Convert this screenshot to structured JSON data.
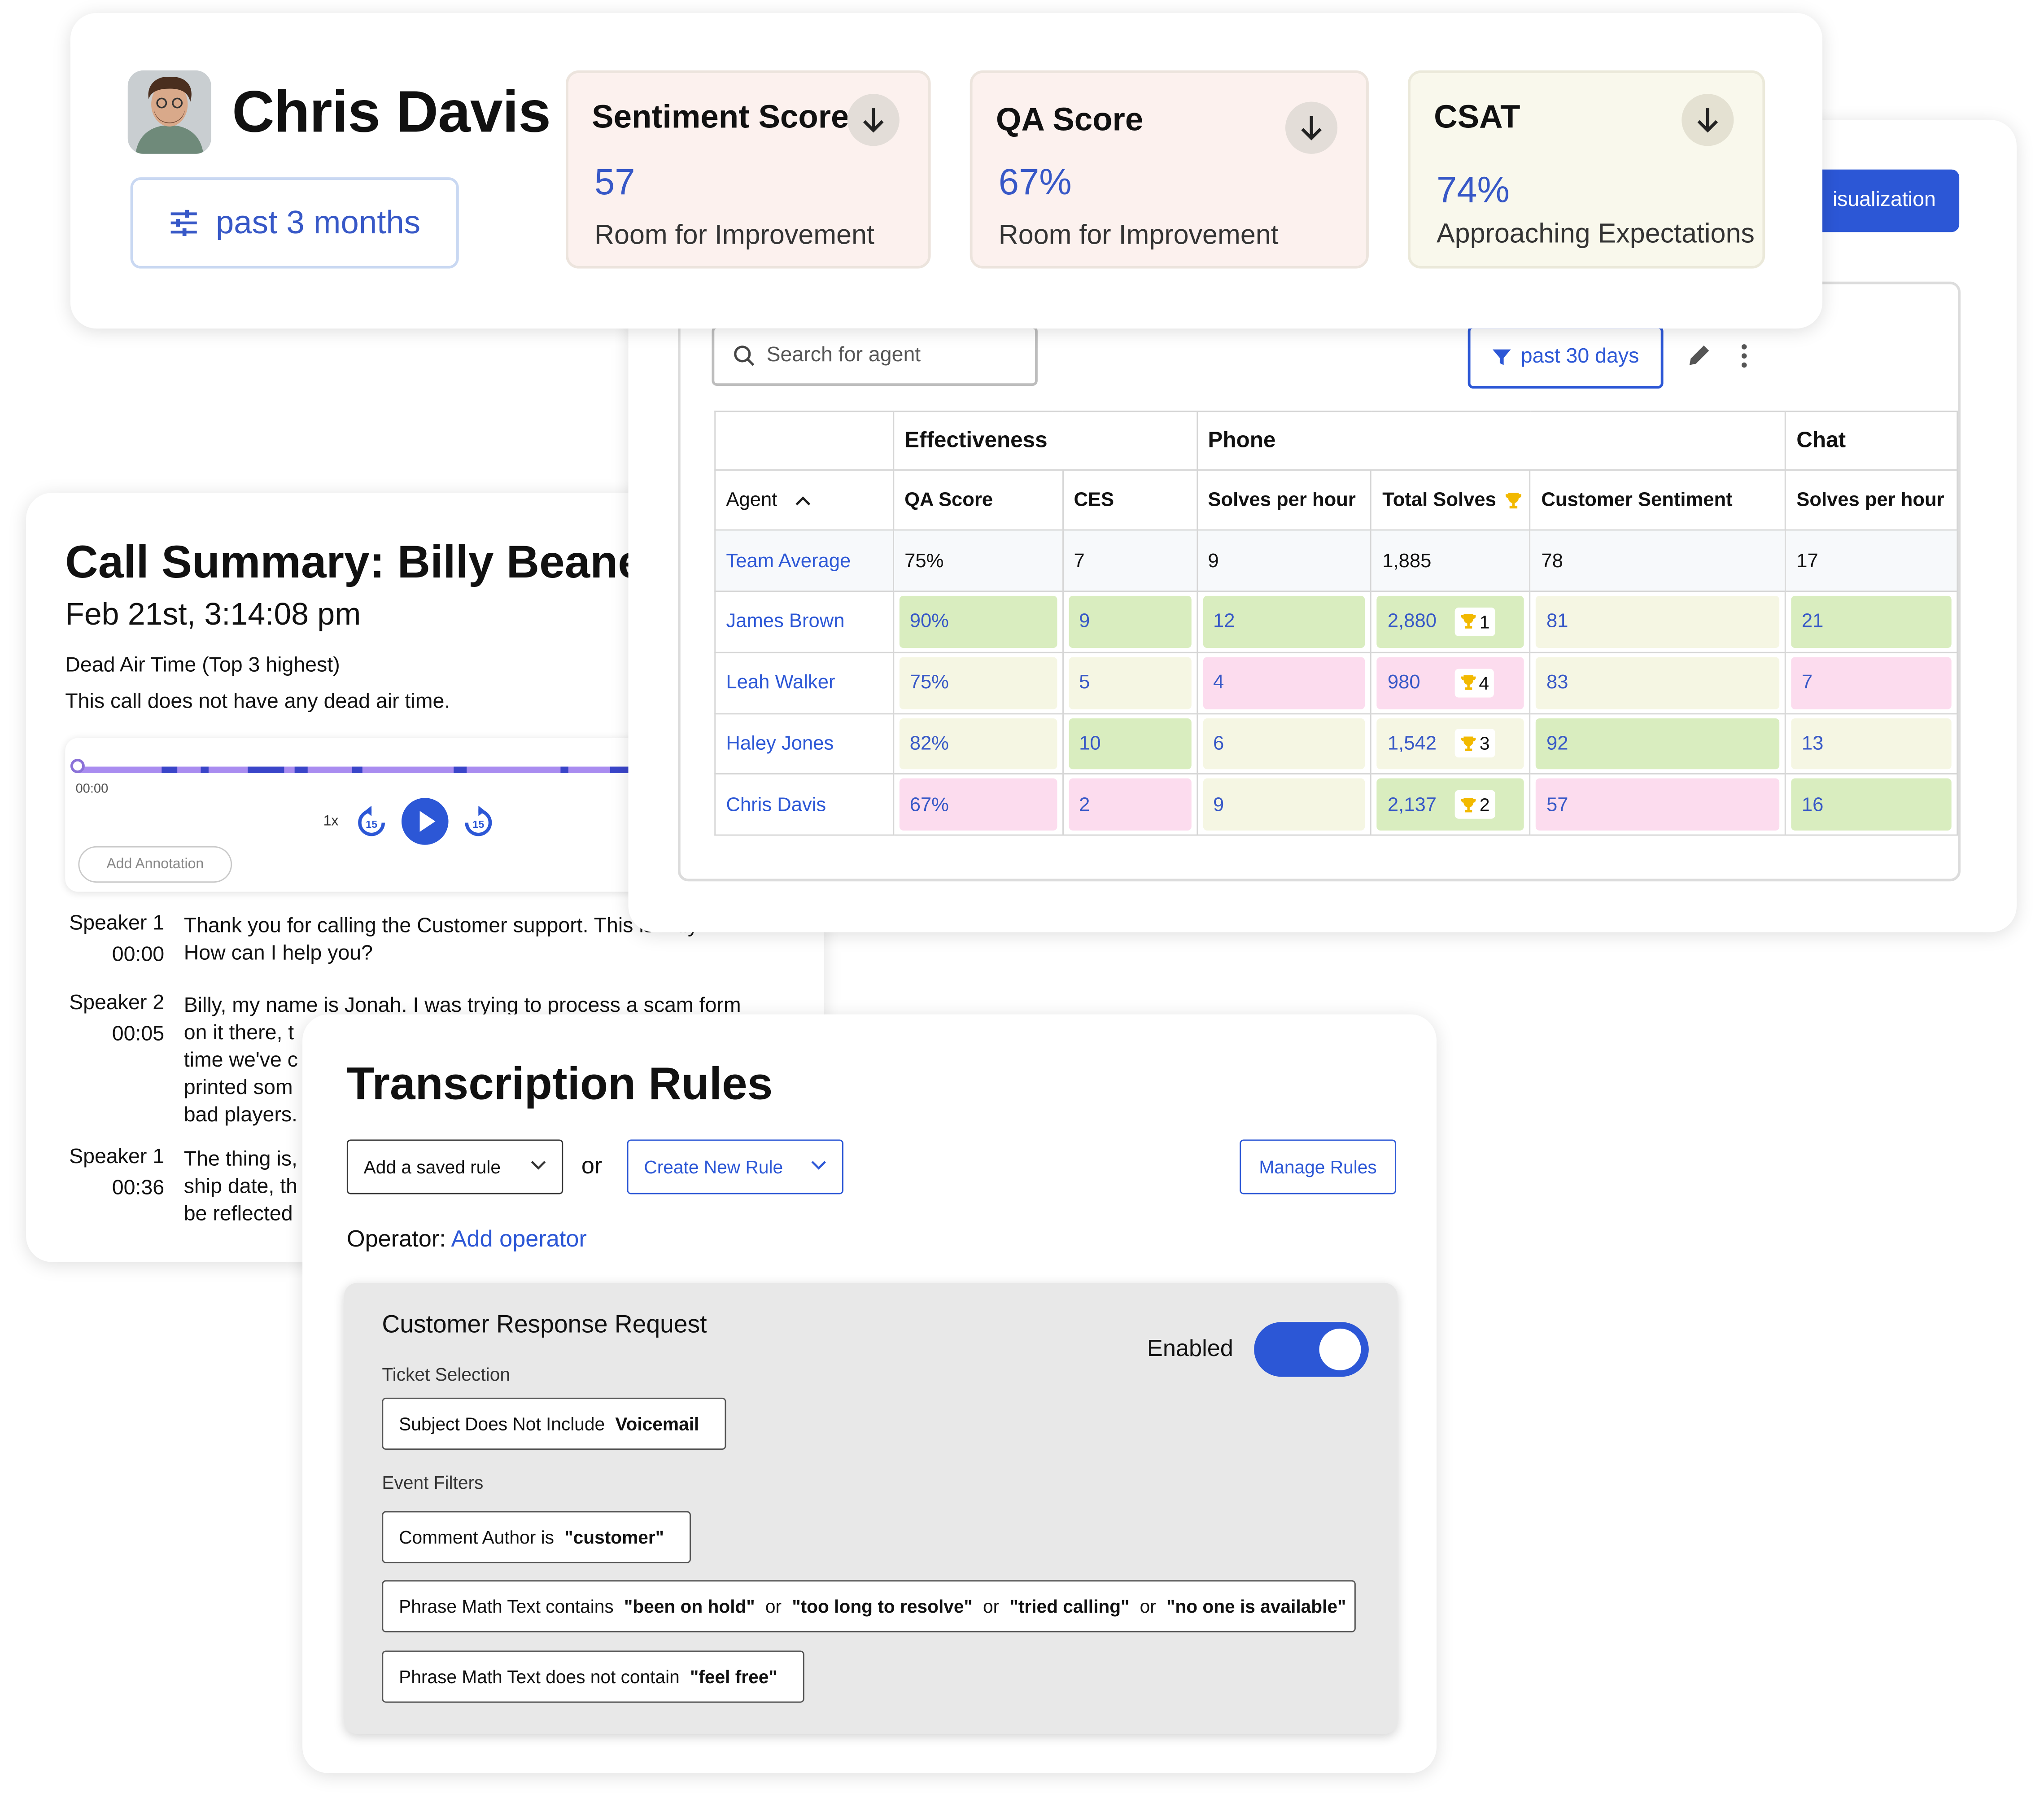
{
  "profile": {
    "name": "Chris Davis",
    "range_label": "past 3 months",
    "metrics": [
      {
        "title": "Sentiment Score",
        "value": "57",
        "desc": "Room for Improvement"
      },
      {
        "title": "QA Score",
        "value": "67%",
        "desc": "Room for Improvement"
      },
      {
        "title": "CSAT",
        "value": "74%",
        "desc": "Approaching Expectations"
      }
    ]
  },
  "table_view": {
    "viz_button": "isualization",
    "search_placeholder": "Search for agent",
    "filter_label": "past 30 days",
    "groups": [
      "Effectiveness",
      "Phone",
      "Chat"
    ],
    "columns": [
      "Agent",
      "QA Score",
      "CES",
      "Solves per hour",
      "Total Solves",
      "Customer Sentiment",
      "Solves per hour"
    ],
    "rows": [
      {
        "agent": "Team Average",
        "qa": "75%",
        "ces": "7",
        "sph": "9",
        "total": "1,885",
        "rank": "",
        "sentiment": "78",
        "chat_sph": "17"
      },
      {
        "agent": "James Brown",
        "qa": "90%",
        "ces": "9",
        "sph": "12",
        "total": "2,880",
        "rank": "1",
        "sentiment": "81",
        "chat_sph": "21"
      },
      {
        "agent": "Leah Walker",
        "qa": "75%",
        "ces": "5",
        "sph": "4",
        "total": "980",
        "rank": "4",
        "sentiment": "83",
        "chat_sph": "7"
      },
      {
        "agent": "Haley Jones",
        "qa": "82%",
        "ces": "10",
        "sph": "6",
        "total": "1,542",
        "rank": "3",
        "sentiment": "92",
        "chat_sph": "13"
      },
      {
        "agent": "Chris Davis",
        "qa": "67%",
        "ces": "2",
        "sph": "9",
        "total": "2,137",
        "rank": "2",
        "sentiment": "57",
        "chat_sph": "16"
      }
    ]
  },
  "call_summary": {
    "title": "Call Summary: Billy Beane",
    "date": "Feb 21st, 3:14:08 pm",
    "dead_air_title": "Dead Air Time (Top 3 highest)",
    "dead_air_body": "This call does not have any dead air time.",
    "player": {
      "time": "00:00",
      "speed": "1x",
      "annotation_button": "Add Annotation"
    },
    "transcript": [
      {
        "speaker": "Speaker 1",
        "time": "00:00",
        "lines": [
          "Thank you for calling the Customer support. This is Billy.",
          "How can I help you?"
        ]
      },
      {
        "speaker": "Speaker 2",
        "time": "00:05",
        "lines": [
          "Billy, my name is Jonah. I was trying to process a scam form",
          "on it there, t",
          "time we've c",
          "printed som",
          "bad players."
        ]
      },
      {
        "speaker": "Speaker 1",
        "time": "00:36",
        "lines": [
          "The thing is,",
          "ship date, th",
          "be reflected"
        ]
      }
    ]
  },
  "rules": {
    "title": "Transcription Rules",
    "saved_rule_label": "Add a saved rule",
    "or_label": "or",
    "create_rule_label": "Create New Rule",
    "manage_label": "Manage Rules",
    "operator_label": "Operator:",
    "operator_link": "Add operator",
    "rule": {
      "name": "Customer Response Request",
      "enabled_label": "Enabled",
      "enabled": true,
      "ticket_section": "Ticket Selection",
      "ticket_chip": {
        "text": "Subject Does Not Include",
        "value": "Voicemail"
      },
      "events_section": "Event Filters",
      "event_chips": [
        {
          "text": "Comment Author is",
          "values": [
            "\"customer\""
          ]
        },
        {
          "text": "Phrase Math Text contains",
          "values": [
            "\"been on hold\"",
            "or",
            "\"too long to resolve\"",
            "or",
            "\"tried calling\"",
            "or",
            "\"no one is available\""
          ]
        },
        {
          "text": "Phrase Math Text does not contain",
          "values": [
            "\"feel free\""
          ]
        }
      ]
    }
  },
  "colors": {
    "accent": "#2c57d6",
    "value_blue": "#3758c7",
    "good": "#d9edbf",
    "neutral": "#f5f6e3",
    "bad": "#fcdcee",
    "trophy": "#f2b900"
  }
}
